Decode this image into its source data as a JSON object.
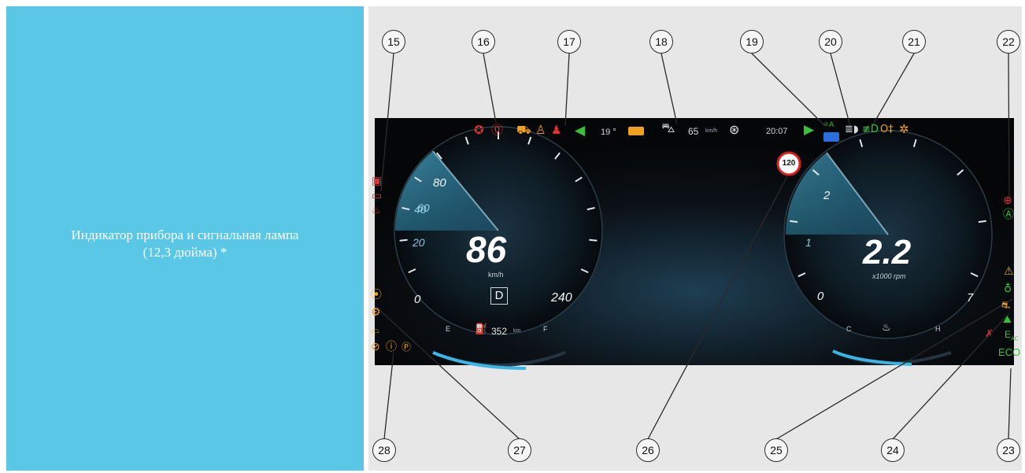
{
  "caption": {
    "line1": "Индикатор прибора и сигнальная лампа",
    "line2": "(12,3 дюйма) *"
  },
  "callout_numbers": [
    "15",
    "16",
    "17",
    "18",
    "19",
    "20",
    "21",
    "22",
    "23",
    "24",
    "25",
    "26",
    "27",
    "28"
  ],
  "cluster": {
    "speed": "86",
    "speed_unit": "km/h",
    "gear": "D",
    "range": "352",
    "range_unit": "km",
    "fuel_empty": "E",
    "fuel_full": "F",
    "speed_ticks": [
      "0",
      "20",
      "40",
      "60",
      "80",
      "240"
    ],
    "rpm": "2.2",
    "rpm_unit": "x1000 rpm",
    "rpm_ticks": [
      "0",
      "1",
      "2",
      "7"
    ],
    "temp_cold": "C",
    "temp_hot": "H",
    "speed_limit_sign": "120",
    "outside_temp": "19 °",
    "cruise_speed": "65",
    "cruise_unit": "km/h",
    "clock": "20:07",
    "eco": "ECO"
  },
  "colors": {
    "red": "#e23030",
    "amber": "#f0a020",
    "green": "#37c23a",
    "blue": "#2a6ee0",
    "white": "#f4f4f4",
    "cyan_accent": "#56c8ee"
  },
  "icons": {
    "airbag": "airbag-warning-icon",
    "brake": "brake-warning-icon",
    "lane_assist": "lane-assist-icon",
    "seatbelt": "seatbelt-icon",
    "turn_left": "turn-signal-left-icon",
    "turn_right": "turn-signal-right-icon",
    "steering": "steering-wheel-icon",
    "adaptive_cruise": "adaptive-cruise-icon",
    "high_beam": "high-beam-icon",
    "fog_front": "front-fog-icon",
    "fog_rear": "rear-fog-icon",
    "headlight_level": "headlight-level-icon",
    "battery": "battery-icon",
    "oil": "oil-pressure-icon",
    "tire_pressure": "tire-pressure-icon",
    "engine_check": "engine-check-icon",
    "epb": "parking-brake-icon",
    "abs": "abs-icon",
    "auto_hold": "auto-hold-icon",
    "master_warning": "master-warning-icon",
    "esp_off": "esp-off-icon",
    "coolant": "coolant-temp-icon",
    "fuel_pump": "fuel-pump-icon"
  }
}
